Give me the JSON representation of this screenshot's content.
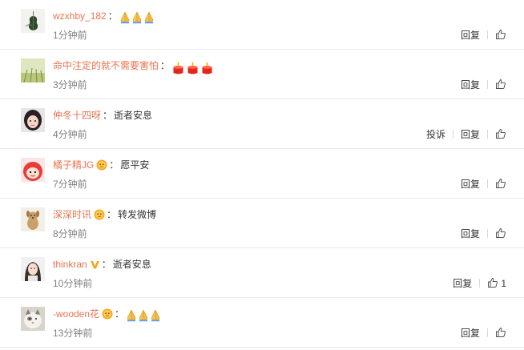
{
  "comments": [
    {
      "name": "wzxhby_182",
      "badge": "",
      "text": "",
      "emoji": "pray-emoji",
      "emoji_count": 3,
      "time": "1分钟前",
      "report": "",
      "reply": "回复",
      "likes": "",
      "avatar": "violin"
    },
    {
      "name": "命中注定的就不需要害怕",
      "badge": "",
      "text": "",
      "emoji": "candle-emoji",
      "emoji_count": 3,
      "time": "3分钟前",
      "report": "",
      "reply": "回复",
      "likes": "",
      "avatar": "field"
    },
    {
      "name": "仲冬十四呀",
      "badge": "",
      "text": "逝者安息",
      "emoji": "",
      "emoji_count": 0,
      "time": "4分钟前",
      "report": "投诉",
      "reply": "回复",
      "likes": "",
      "avatar": "girl"
    },
    {
      "name": "橘子精JG",
      "badge": "vip-badge",
      "text": "愿平安",
      "emoji": "",
      "emoji_count": 0,
      "time": "7分钟前",
      "report": "",
      "reply": "回复",
      "likes": "",
      "avatar": "cartoon"
    },
    {
      "name": "深深时讯",
      "badge": "vip-badge",
      "text": "转发微博",
      "emoji": "",
      "emoji_count": 0,
      "time": "8分钟前",
      "report": "",
      "reply": "回复",
      "likes": "",
      "avatar": "dog"
    },
    {
      "name": "thinkran",
      "badge": "verified-v-badge",
      "text": "逝者安息",
      "emoji": "",
      "emoji_count": 0,
      "time": "10分钟前",
      "report": "",
      "reply": "回复",
      "likes": "1",
      "avatar": "woman"
    },
    {
      "name": "-wooden花",
      "badge": "vip-badge",
      "text": "",
      "emoji": "pray-emoji",
      "emoji_count": 3,
      "time": "13分钟前",
      "report": "",
      "reply": "回复",
      "likes": "",
      "avatar": "cat"
    }
  ],
  "colors": {
    "name": "#eb7350",
    "time": "#808080",
    "divider": "#eaeaea"
  }
}
